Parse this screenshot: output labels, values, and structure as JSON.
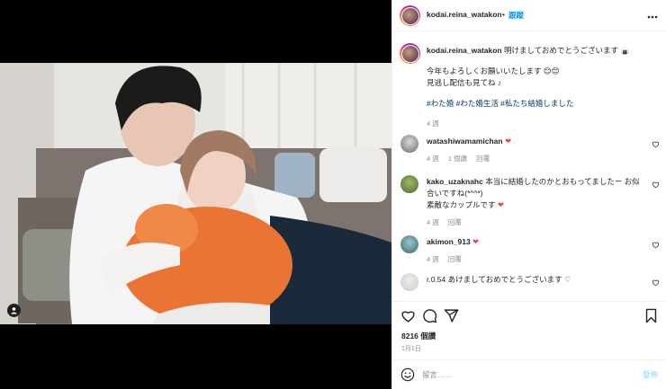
{
  "post": {
    "username": "kodai.reina_watakon",
    "follow_label": "跟蹤",
    "dot": "•",
    "more": "•••"
  },
  "caption": {
    "username": "kodai.reina_watakon",
    "line1": "明けましておめでとうございます",
    "line2": "今年もよろしくお願いいたします",
    "line3": "見逃し配信も見てね",
    "hashtags": "#わた婚 #わた婚生活 #私たち結婚しました",
    "time": "4 週"
  },
  "comments": [
    {
      "username": "watashiwamamichan",
      "text": "",
      "time": "4 週",
      "likes": "1 個讚",
      "reply": "回覆"
    },
    {
      "username": "kako_uzaknahc",
      "text": "本当に結婚したのかとおもってましたー お似合いですね(*^^*)",
      "text2": "素敵なカップルです",
      "time": "4 週",
      "reply": "回覆"
    },
    {
      "username": "akimon_913",
      "text": "",
      "time": "4 週",
      "reply": "回覆"
    },
    {
      "username": "r.0.54",
      "text": "あけましておめでとうございます",
      "time": "",
      "reply": ""
    }
  ],
  "stats": {
    "likes": "8216 個讚",
    "date": "1月1日"
  },
  "composer": {
    "placeholder": "留言……",
    "post_label": "發佈"
  },
  "colors": {
    "accent": "#0095f6",
    "heart": "#ed4956",
    "muted": "#8e8e8e"
  },
  "icons": [
    "more-icon",
    "heart-icon",
    "comment-icon",
    "share-icon",
    "bookmark-icon",
    "emoji-icon",
    "user-tag-icon"
  ]
}
